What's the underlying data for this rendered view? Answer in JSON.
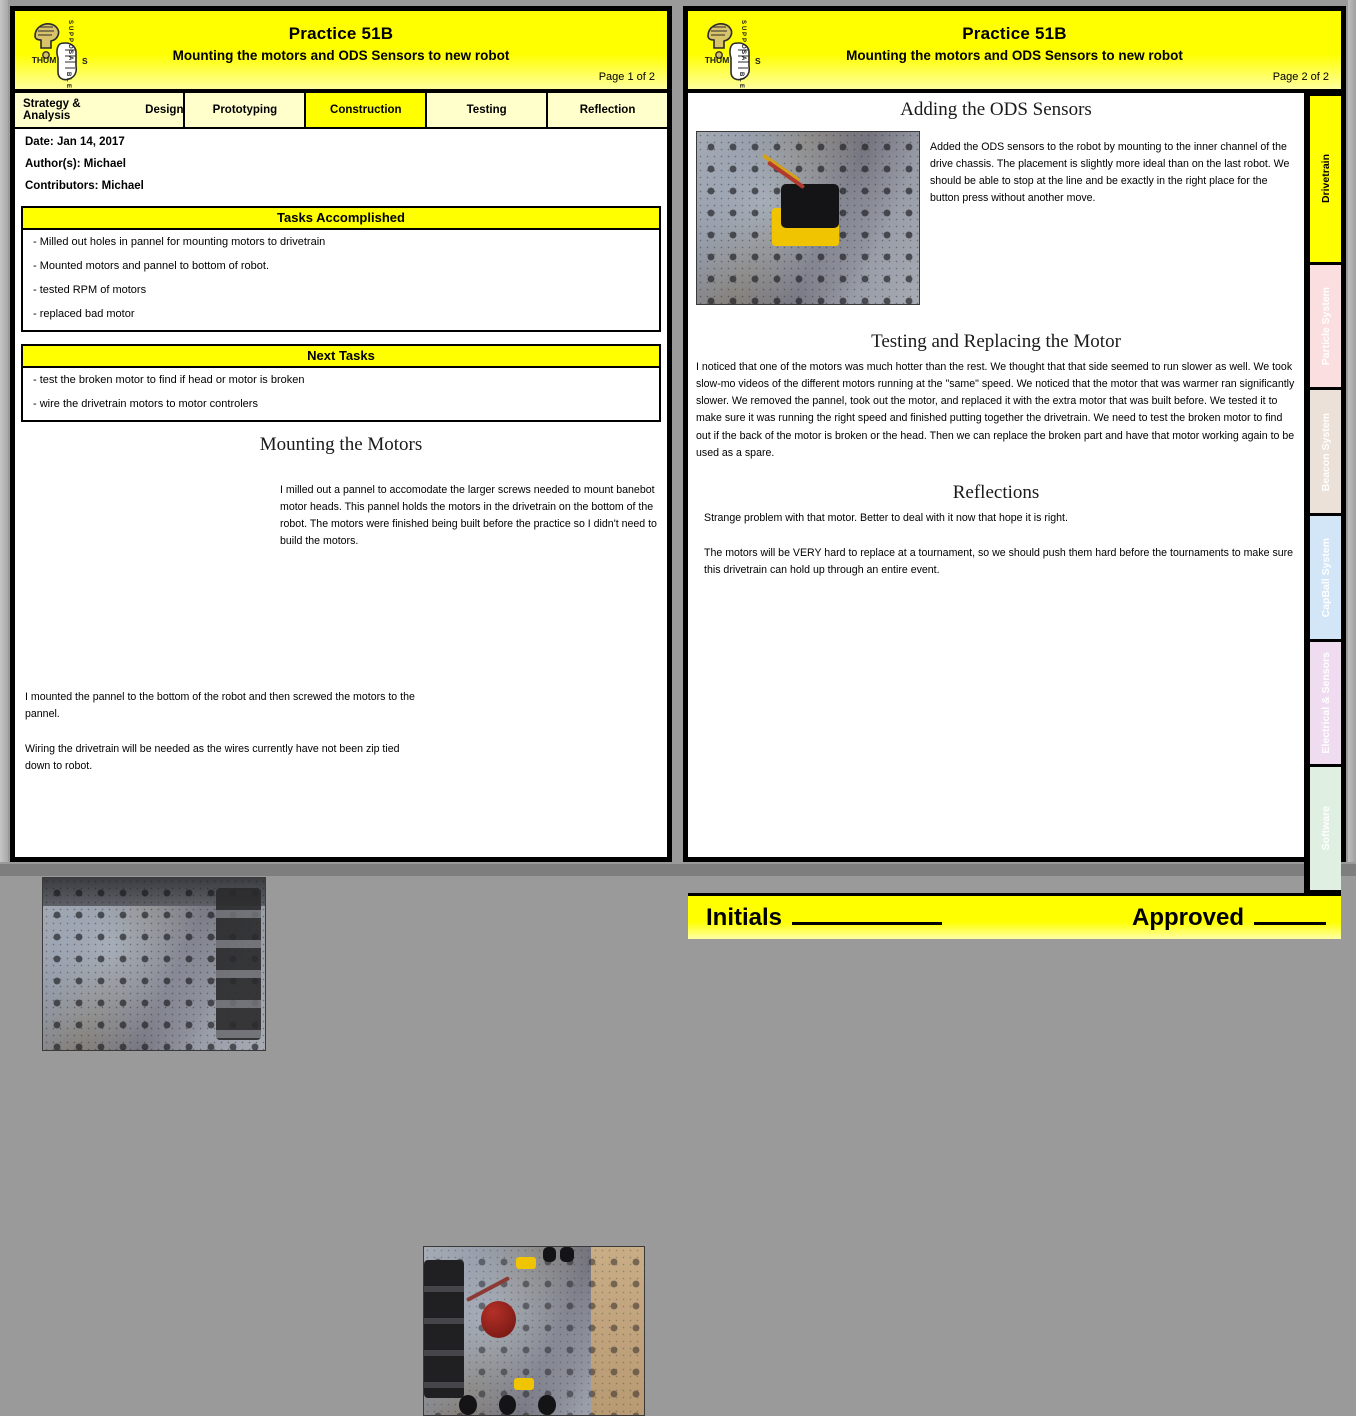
{
  "logo": {
    "thumb_text": "THUM",
    "s_text": "S",
    "vertical_text": "SUPPOSABLE",
    "icon": "thumbs-up-hand-icon"
  },
  "page_left": {
    "header": {
      "title": "Practice 51B",
      "subtitle": "Mounting the motors and ODS Sensors to new robot",
      "page_label": "Page 1 of 2"
    },
    "tabs": [
      {
        "label": "Strategy & Analysis",
        "active": false
      },
      {
        "label": "Design",
        "active": false
      },
      {
        "label": "Prototyping",
        "active": false
      },
      {
        "label": "Construction",
        "active": true
      },
      {
        "label": "Testing",
        "active": false
      },
      {
        "label": "Reflection",
        "active": false
      }
    ],
    "meta": {
      "date": "Date: Jan 14, 2017",
      "authors": "Author(s): Michael",
      "contributors": "Contributors: Michael"
    },
    "tasks_accomplished": {
      "title": "Tasks Accomplished",
      "items": [
        "-  Milled out holes in pannel for mounting motors to drivetrain",
        "-  Mounted motors and pannel to bottom of robot.",
        "-  tested RPM of motors",
        "-  replaced bad motor"
      ]
    },
    "next_tasks": {
      "title": "Next Tasks",
      "items": [
        "-  test the broken motor to find if head or motor is broken",
        "-  wire the drivetrain motors to motor controlers"
      ]
    },
    "mounting": {
      "title": "Mounting the Motors",
      "paragraph": "I milled out a pannel to accomodate the larger screws needed to mount banebot motor heads. This pannel holds the motors in the drivetrain on the bottom of the robot. The motors were finished being built before the practice so I didn't need to build the motors.",
      "photo1_alt": "milled-aluminium-pannel-photo",
      "photo2_alt": "robot-underside-drivetrain-photo",
      "paragraph2": "I mounted the pannel to the bottom of the robot and then screwed the motors to the pannel.",
      "paragraph3": "Wiring the drivetrain will be needed as the wires currently have not been zip tied down to robot."
    }
  },
  "page_right": {
    "header": {
      "title": "Practice 51B",
      "subtitle": "Mounting the motors and ODS Sensors to new robot",
      "page_label": "Page 2 of 2"
    },
    "ods": {
      "title": "Adding the ODS Sensors",
      "photo_alt": "ods-sensor-mounted-photo",
      "paragraph": "Added the ODS sensors to the robot by mounting to the inner channel of the drive chassis.  The placement is slightly more ideal than on the last robot.  We should be able to stop at the line and be exactly in the right place for the button press without another move."
    },
    "testing": {
      "title": "Testing and Replacing the Motor",
      "paragraph": "I noticed that one of the motors was much hotter than the rest. We thought that that side seemed to run slower as well. We took slow-mo videos of the different motors running at the \"same\" speed. We noticed that the motor that was warmer ran significantly slower. We removed the pannel, took out the motor, and replaced it with the extra motor that was built before. We tested it to make sure it was running the right speed and finished putting together the drivetrain. We need to test the broken motor to find out if the back of the motor is broken or the head. Then we can replace the broken part and have that motor working again to be used as a spare."
    },
    "reflections": {
      "title": "Reflections",
      "paragraph1": "Strange problem with that motor.  Better to deal with it now that hope it is right.",
      "paragraph2": "The motors will be VERY hard to replace at a tournament, so we should push them hard before the tournaments to make sure this drivetrain can hold up through an entire event."
    },
    "side_tabs": [
      {
        "label": "Drivetrain",
        "color": "#ffff00",
        "active": true
      },
      {
        "label": "Particle System",
        "color": "#fbdfe0",
        "active": false
      },
      {
        "label": "Beacon System",
        "color": "#ece1d8",
        "active": false
      },
      {
        "label": "CapBall System",
        "color": "#d3e6f7",
        "active": false
      },
      {
        "label": "Electrical & Sensors",
        "color": "#f0dcf0",
        "active": false
      },
      {
        "label": "Software",
        "color": "#dff0e2",
        "active": false
      }
    ],
    "footer": {
      "initials_label": "Initials",
      "approved_label": "Approved"
    }
  },
  "colors": {
    "brand_yellow": "#ffff00",
    "tab_pale_yellow": "#ffffcc",
    "page_border": "#000000",
    "desktop_gray": "#9a9a9a"
  }
}
